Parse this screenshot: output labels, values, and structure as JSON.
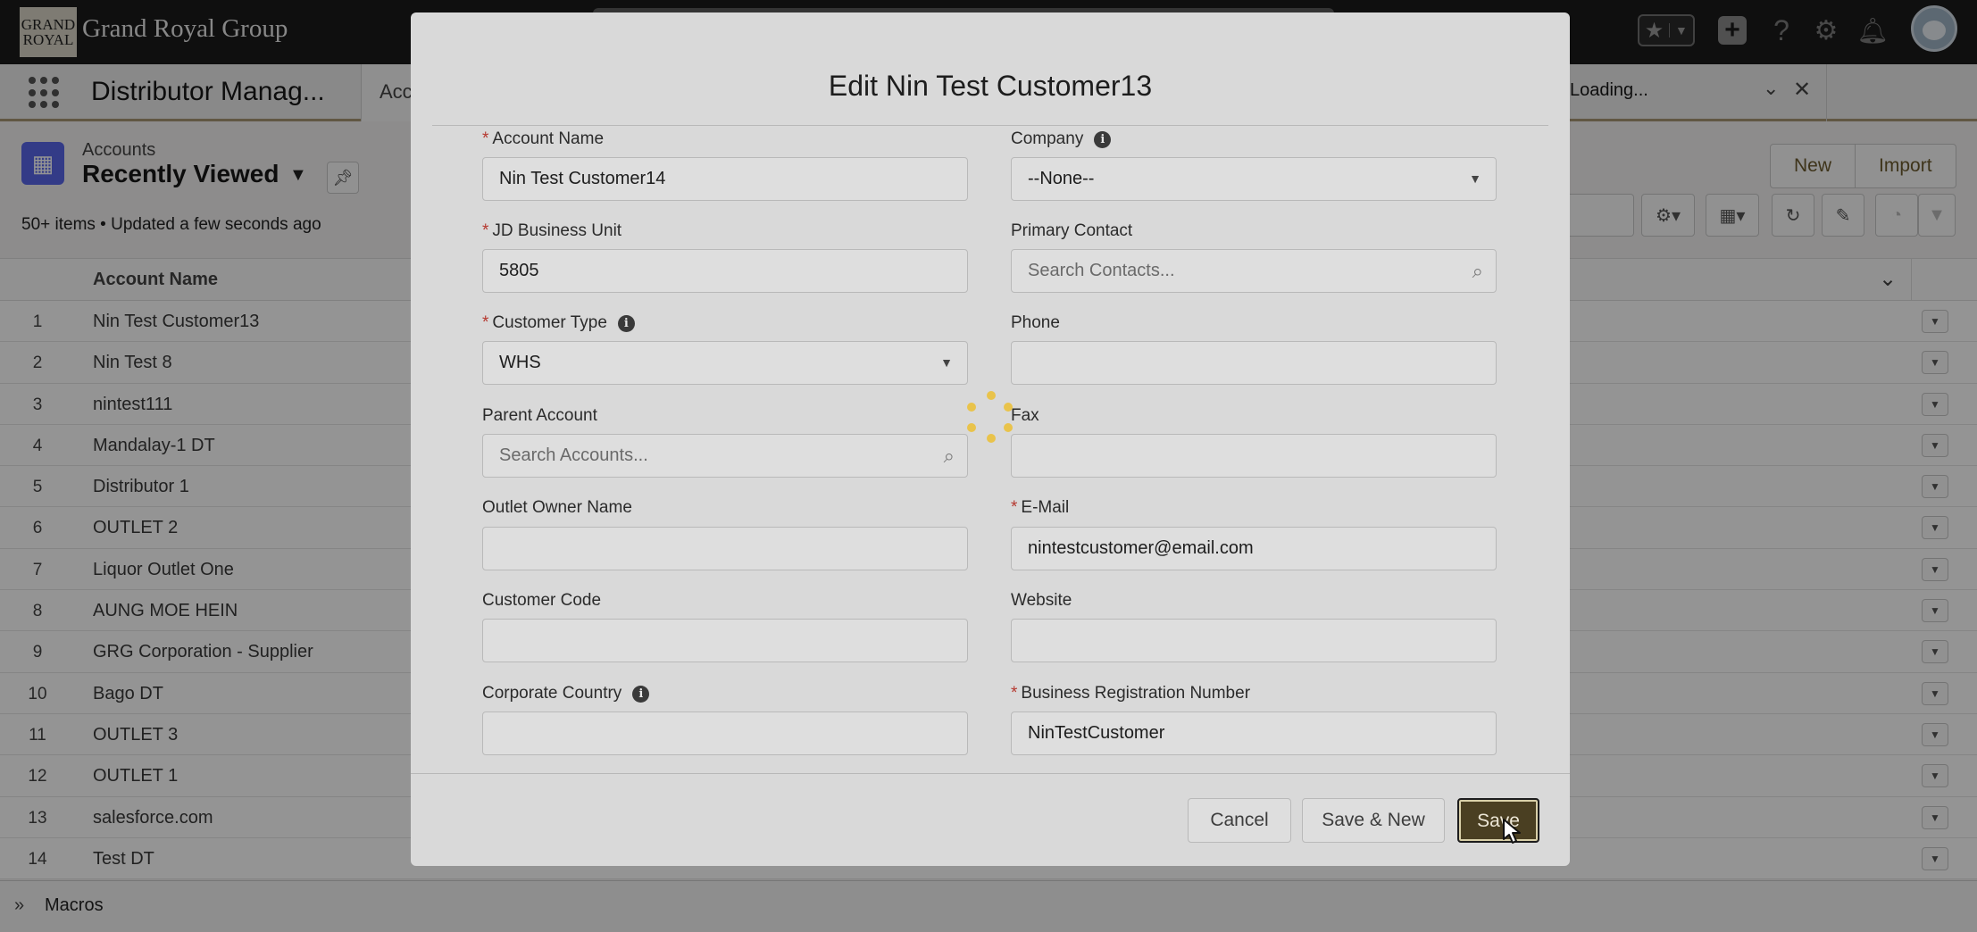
{
  "header": {
    "logo_line1": "GRAND",
    "logo_line2": "ROYAL",
    "brand": "Grand Royal Group",
    "icons": [
      "star-icon",
      "chevron-down-icon",
      "plus-icon",
      "help-icon",
      "gear-icon",
      "bell-icon",
      "avatar"
    ]
  },
  "nav": {
    "app_name": "Distributor Manag...",
    "tab_partial": "Acco",
    "loading_tab": "Loading..."
  },
  "list": {
    "object_label": "Accounts",
    "list_name": "Recently Viewed",
    "meta": "50+ items • Updated a few seconds ago",
    "new_button": "New",
    "import_button": "Import",
    "column_header": "Account Name",
    "rows": [
      {
        "num": "1",
        "name": "Nin Test Customer13"
      },
      {
        "num": "2",
        "name": "Nin Test 8"
      },
      {
        "num": "3",
        "name": "nintest111"
      },
      {
        "num": "4",
        "name": "Mandalay-1 DT"
      },
      {
        "num": "5",
        "name": "Distributor 1"
      },
      {
        "num": "6",
        "name": "OUTLET 2"
      },
      {
        "num": "7",
        "name": "Liquor Outlet One"
      },
      {
        "num": "8",
        "name": "AUNG MOE HEIN"
      },
      {
        "num": "9",
        "name": "GRG Corporation - Supplier"
      },
      {
        "num": "10",
        "name": "Bago DT"
      },
      {
        "num": "11",
        "name": "OUTLET 3"
      },
      {
        "num": "12",
        "name": "OUTLET 1"
      },
      {
        "num": "13",
        "name": "salesforce.com"
      },
      {
        "num": "14",
        "name": "Test DT"
      }
    ]
  },
  "footer": {
    "label": "Macros"
  },
  "modal": {
    "title": "Edit Nin Test Customer13",
    "fields": {
      "account_name": {
        "label": "Account Name",
        "value": "Nin Test Customer14"
      },
      "company": {
        "label": "Company",
        "value": "--None--"
      },
      "jd_business_unit": {
        "label": "JD Business Unit",
        "value": "5805"
      },
      "primary_contact": {
        "label": "Primary Contact",
        "placeholder": "Search Contacts..."
      },
      "customer_type": {
        "label": "Customer Type",
        "value": "WHS"
      },
      "phone": {
        "label": "Phone",
        "value": ""
      },
      "parent_account": {
        "label": "Parent Account",
        "placeholder": "Search Accounts..."
      },
      "fax": {
        "label": "Fax",
        "value": ""
      },
      "outlet_owner_name": {
        "label": "Outlet Owner Name",
        "value": ""
      },
      "email": {
        "label": "E-Mail",
        "value": "nintestcustomer@email.com"
      },
      "customer_code": {
        "label": "Customer Code",
        "value": ""
      },
      "website": {
        "label": "Website",
        "value": ""
      },
      "corporate_country": {
        "label": "Corporate Country",
        "value": ""
      },
      "business_registration_number": {
        "label": "Business Registration Number",
        "value": "NinTestCustomer"
      }
    },
    "required_marker": "*",
    "buttons": {
      "cancel": "Cancel",
      "save_new": "Save & New",
      "save": "Save"
    }
  },
  "colors": {
    "brand_accent": "#4a3f22",
    "required": "#b5382f",
    "spinner": "#e9c34b",
    "object_icon": "#5867e8"
  }
}
